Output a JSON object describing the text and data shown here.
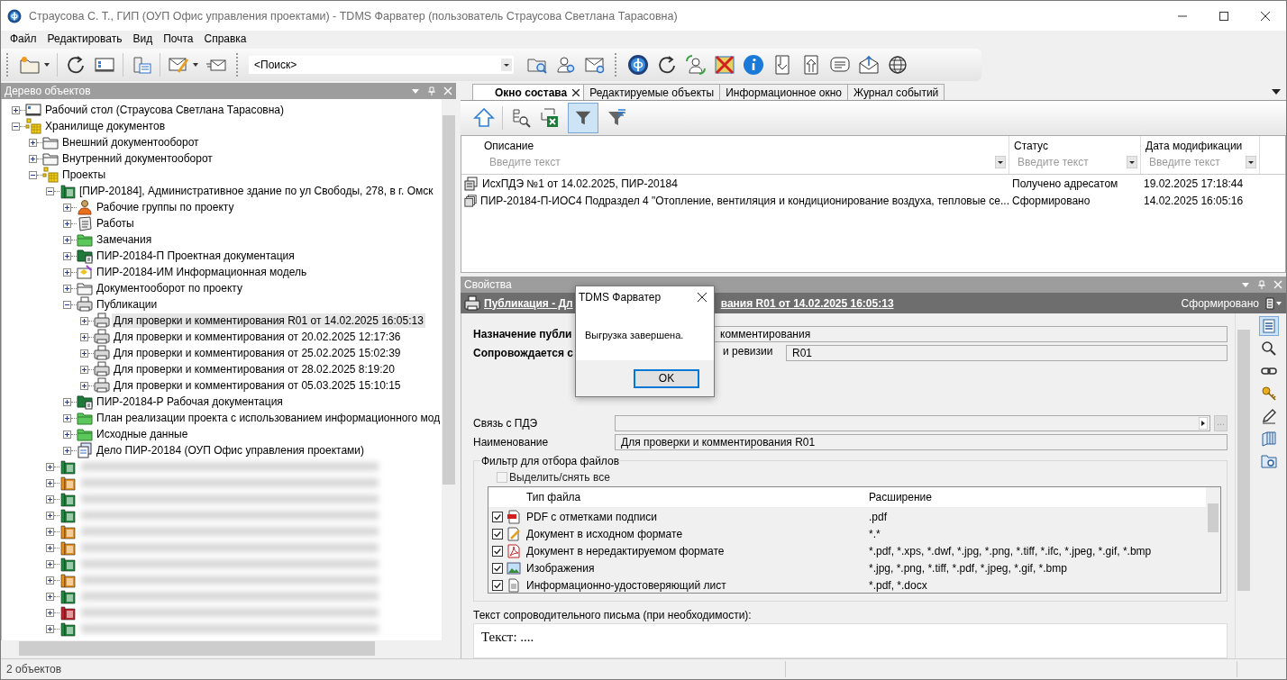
{
  "window": {
    "title": "Страусова С. Т., ГИП (ОУП Офис управления проектами) - TDMS Фарватер (пользователь Страусова Светлана Тарасовна)"
  },
  "menu": [
    "Файл",
    "Редактировать",
    "Вид",
    "Почта",
    "Справка"
  ],
  "search": {
    "value": "<Поиск>"
  },
  "tree_panel": {
    "title": "Дерево объектов"
  },
  "tree": [
    {
      "label": "Рабочий стол (Страусова Светлана Тарасовна)",
      "kind": "desktop",
      "expanded": false,
      "selected": false
    },
    {
      "label": "Хранилище документов",
      "kind": "storage",
      "expanded": true,
      "selected": false,
      "children": [
        {
          "label": "Внешний документооборот",
          "kind": "folder",
          "expanded": false,
          "selected": false
        },
        {
          "label": "Внутренний документооборот",
          "kind": "folder",
          "expanded": false,
          "selected": false
        },
        {
          "label": "Проекты",
          "kind": "storage",
          "expanded": true,
          "selected": false,
          "children": [
            {
              "label": "[ПИР-20184], Административное здание по ул Свободы, 278, в г. Омск",
              "kind": "project",
              "color": "#1f8a3f",
              "expanded": true,
              "selected": false,
              "children": [
                {
                  "label": "Рабочие группы по проекту",
                  "kind": "group",
                  "expanded": false,
                  "selected": false
                },
                {
                  "label": "Работы",
                  "kind": "works",
                  "expanded": false,
                  "selected": false
                },
                {
                  "label": "Замечания",
                  "kind": "green-folder",
                  "expanded": false,
                  "selected": false
                },
                {
                  "label": "ПИР-20184-П Проектная документация",
                  "kind": "doc-folder",
                  "expanded": false,
                  "selected": false
                },
                {
                  "label": "ПИР-20184-ИМ Информационная модель",
                  "kind": "model",
                  "expanded": false,
                  "selected": false
                },
                {
                  "label": "Документооборот по проекту",
                  "kind": "folder",
                  "expanded": false,
                  "selected": false
                },
                {
                  "label": "Публикации",
                  "kind": "publication",
                  "expanded": true,
                  "selected": false,
                  "children": [
                    {
                      "label": "Для проверки и комментирования R01 от 14.02.2025 16:05:13",
                      "kind": "publication",
                      "expanded": false,
                      "selected": true
                    },
                    {
                      "label": "Для проверки и комментирования от 20.02.2025 12:17:36",
                      "kind": "publication",
                      "expanded": false,
                      "selected": false
                    },
                    {
                      "label": "Для проверки и комментирования от 25.02.2025 15:02:39",
                      "kind": "publication",
                      "expanded": false,
                      "selected": false
                    },
                    {
                      "label": "Для проверки и комментирования от 28.02.2025 8:19:20",
                      "kind": "publication",
                      "expanded": false,
                      "selected": false
                    },
                    {
                      "label": "Для проверки и комментирования от 05.03.2025 15:10:15",
                      "kind": "publication",
                      "expanded": false,
                      "selected": false
                    }
                  ]
                },
                {
                  "label": "ПИР-20184-Р Рабочая документация",
                  "kind": "doc-folder",
                  "expanded": false,
                  "selected": false
                },
                {
                  "label": "План реализации проекта с использованием информационного мод",
                  "kind": "green-folder",
                  "expanded": false,
                  "selected": false
                },
                {
                  "label": "Исходные данные",
                  "kind": "green-folder",
                  "expanded": false,
                  "selected": false
                },
                {
                  "label": "Дело  ПИР-20184 (ОУП Офис управления проектами)",
                  "kind": "case",
                  "expanded": false,
                  "selected": false
                }
              ]
            },
            {
              "kind": "project",
              "color": "#1f8a3f",
              "expanded": false,
              "selected": false
            },
            {
              "kind": "project",
              "color": "#e8901c",
              "expanded": false,
              "selected": false
            },
            {
              "kind": "project",
              "color": "#1f8a3f",
              "expanded": false,
              "selected": false
            },
            {
              "kind": "project",
              "color": "#1f8a3f",
              "expanded": false,
              "selected": false
            },
            {
              "kind": "project",
              "color": "#e8901c",
              "expanded": false,
              "selected": false
            },
            {
              "kind": "project",
              "color": "#e8901c",
              "expanded": false,
              "selected": false
            },
            {
              "kind": "project",
              "color": "#1f8a3f",
              "expanded": false,
              "selected": false
            },
            {
              "kind": "project",
              "color": "#e8901c",
              "expanded": false,
              "selected": false
            },
            {
              "kind": "project",
              "color": "#1f8a3f",
              "expanded": false,
              "selected": false
            },
            {
              "kind": "project",
              "color": "#c0202a",
              "expanded": false,
              "selected": false
            },
            {
              "kind": "project",
              "color": "#1f8a3f",
              "expanded": false,
              "selected": false
            }
          ]
        }
      ]
    }
  ],
  "status_bar": "2 объектов",
  "tabs": [
    {
      "label": "Окно состава",
      "selected": true
    },
    {
      "label": "Редактируемые объекты",
      "selected": false
    },
    {
      "label": "Информационное окно",
      "selected": false
    },
    {
      "label": "Журнал событий",
      "selected": false
    }
  ],
  "composition_toolbar": {
    "filter_active": true
  },
  "table": {
    "columns": [
      {
        "label": "Описание",
        "placeholder": "Введите текст"
      },
      {
        "label": "Статус",
        "placeholder": "Введите текст"
      },
      {
        "label": "Дата модификации",
        "placeholder": "Введите текст"
      }
    ],
    "rows": [
      {
        "kind": "letter",
        "description": "ИсхПДЭ №1 от 14.02.2025, ПИР-20184",
        "status": "Получено адресатом",
        "date": "19.02.2025 17:18:44"
      },
      {
        "kind": "stack",
        "description": "ПИР-20184-П-ИОС4 Подраздел 4 \"Отопление, вентиляция и кондиционирование воздуха, тепловые се...",
        "status": "Сформировано",
        "date": "14.02.2025 16:05:16"
      }
    ]
  },
  "properties": {
    "title": "Свойства",
    "heading_left": "Публикация - Дл",
    "heading_right": "вания R01 от 14.02.2025 16:05:13",
    "status": "Сформировано",
    "purpose_label": "Назначение публи",
    "purpose_value": "комментирования",
    "accompanied_label": "Сопровождается с",
    "revision_label": "и ревизии",
    "revision_value": "R01",
    "pde_label": "Связь с ПДЭ",
    "pde_browse": "...",
    "name_label": "Наименование",
    "name_value": "Для проверки и комментирования R01",
    "filter_group": "Фильтр для отбора файлов",
    "select_all": {
      "label": "Выделить/снять все",
      "checked": false,
      "disabled": true
    },
    "file_columns": [
      "Тип файла",
      "Расширение"
    ],
    "files": [
      {
        "kind": "pdf-sign",
        "checked": true,
        "type": "PDF с отметками подписи",
        "ext": ".pdf"
      },
      {
        "kind": "edit",
        "checked": true,
        "type": "Документ в исходном формате",
        "ext": "*.*"
      },
      {
        "kind": "pdf",
        "checked": true,
        "type": "Документ в нередактируемом формате",
        "ext": "*.pdf, *.xps, *.dwf, *.jpg, *.png, *.tiff, *.ifc,  *.jpeg, *.gif, *.bmp"
      },
      {
        "kind": "image",
        "checked": true,
        "type": "Изображения",
        "ext": "*.jpg, *.png, *.tiff, *.pdf,  *.jpeg, *.gif, *.bmp"
      },
      {
        "kind": "sheet",
        "checked": true,
        "type": "Информационно-удостоверяющий лист",
        "ext": "*.pdf, *.docx"
      }
    ],
    "letter_label": "Текст сопроводительного письма (при необходимости):",
    "letter_value": "Текст: ...."
  },
  "dialog": {
    "title": "TDMS Фарватер",
    "message": "Выгрузка завершена.",
    "button": "OK"
  }
}
